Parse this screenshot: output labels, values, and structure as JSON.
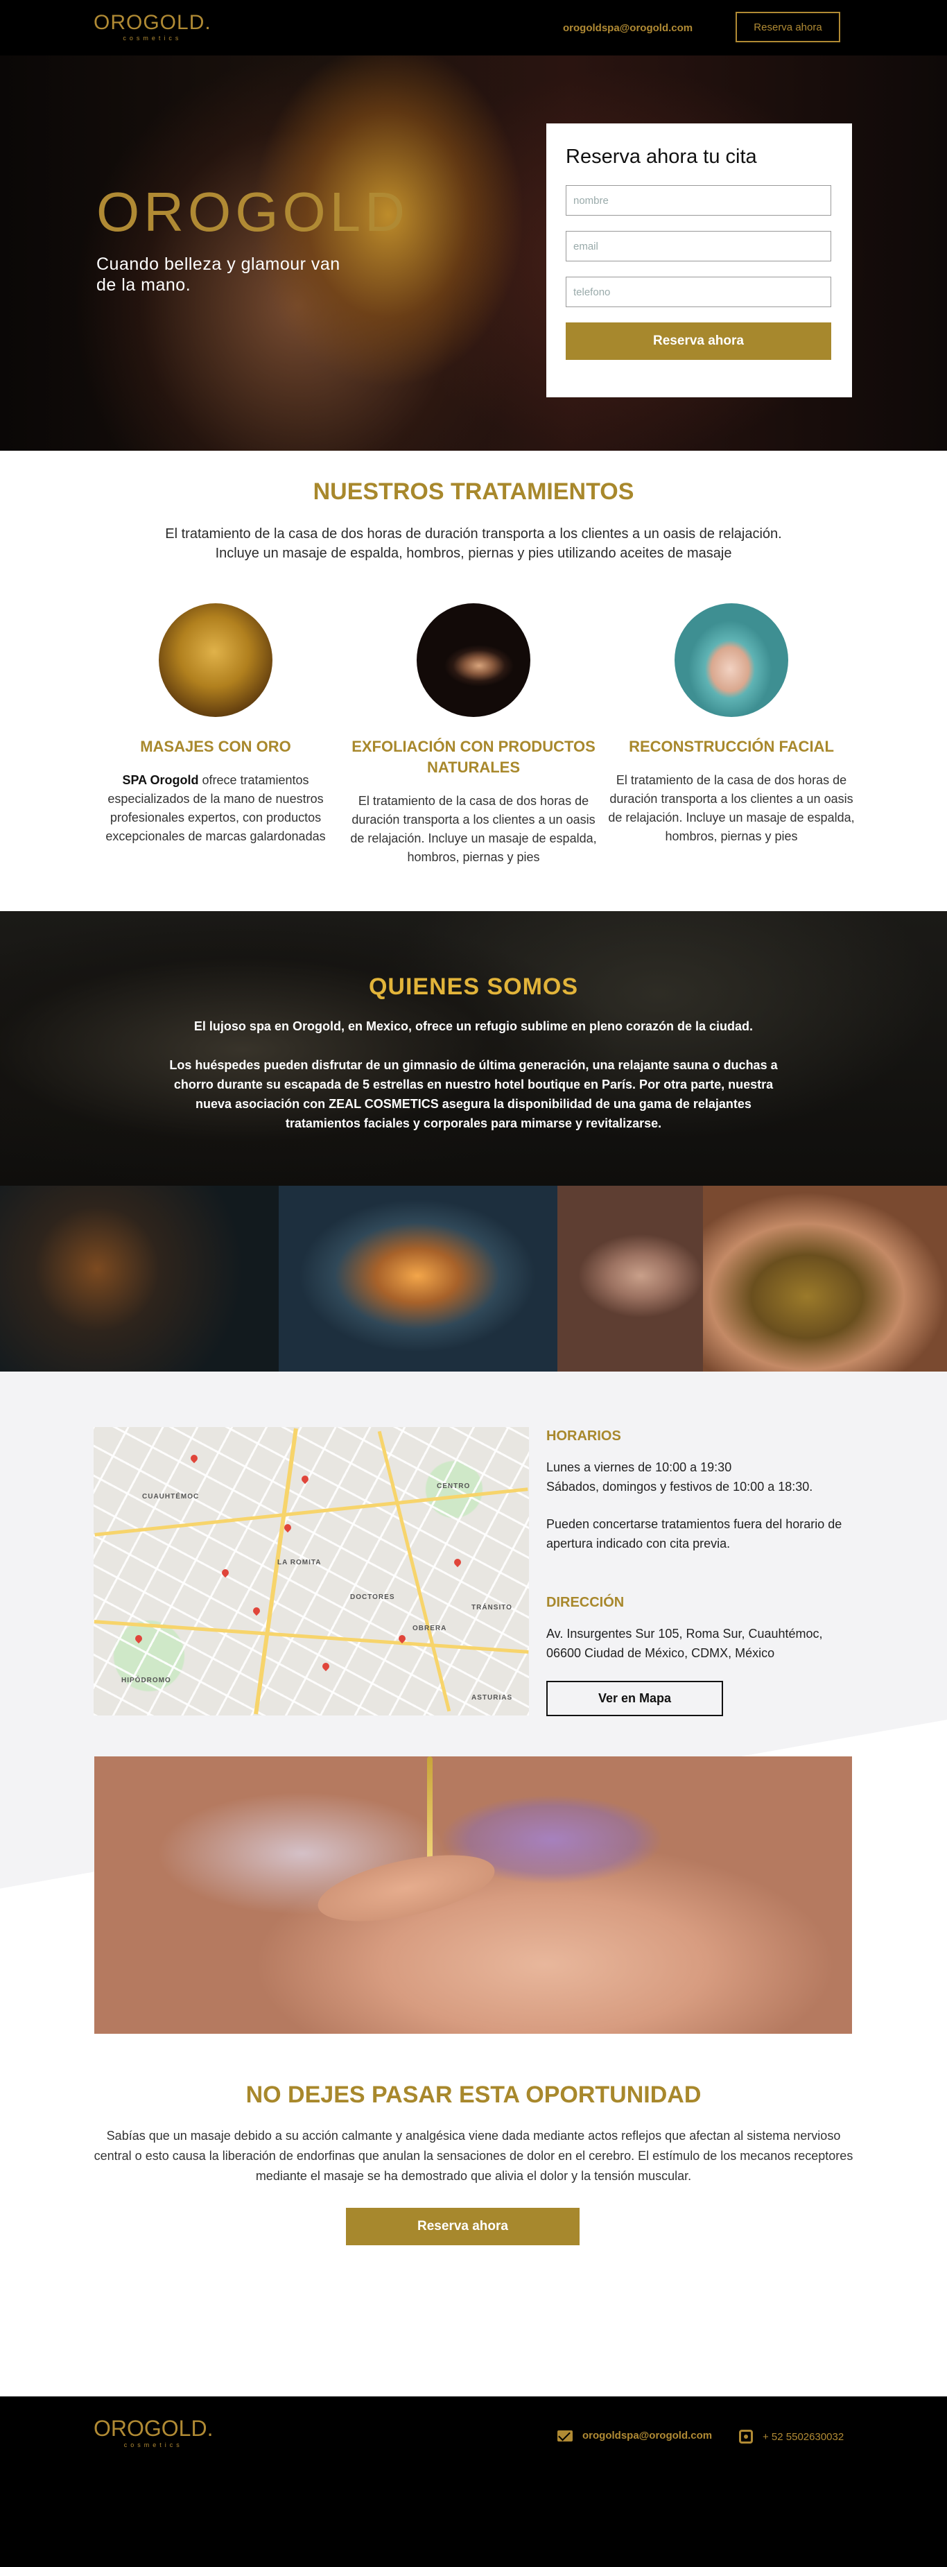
{
  "header": {
    "logo_main": "OROGOLD.",
    "logo_sub": "cosmetics",
    "email": "orogoldspa@orogold.com",
    "cta": "Reserva ahora"
  },
  "hero": {
    "title": "OROGOLD",
    "subtitle": "Cuando belleza y glamour van de la mano."
  },
  "booking": {
    "title": "Reserva ahora tu cita",
    "name_placeholder": "nombre",
    "email_placeholder": "email",
    "phone_placeholder": "telefono",
    "button": "Reserva ahora"
  },
  "treatments": {
    "title": "NUESTROS TRATAMIENTOS",
    "intro": "El tratamiento de la casa de dos horas de duración transporta a los clientes a un oasis de relajación. Incluye un masaje de espalda, hombros, piernas y pies utilizando aceites de masaje",
    "items": [
      {
        "title": "MASAJES CON ORO",
        "text_bold": "SPA Orogold",
        "text": " ofrece tratamientos especializados de la mano de nuestros profesionales expertos, con productos excepcionales de marcas galardonadas"
      },
      {
        "title": "EXFOLIACIÓN CON PRODUCTOS NATURALES",
        "text": "El tratamiento de la casa de dos horas de duración transporta a los clientes a un oasis de relajación. Incluye un masaje de espalda, hombros, piernas y pies"
      },
      {
        "title": "RECONSTRUCCIÓN FACIAL",
        "text": "El tratamiento de la casa de dos horas de duración transporta a los clientes a un oasis de relajación. Incluye un masaje de espalda, hombros, piernas y pies"
      }
    ]
  },
  "about": {
    "title": "QUIENES SOMOS",
    "p1": "El lujoso spa en Orogold, en Mexico, ofrece un refugio sublime en pleno corazón de la ciudad.",
    "p2": "Los huéspedes pueden disfrutar de un gimnasio de última generación, una relajante sauna o duchas a chorro durante su escapada de 5 estrellas en nuestro hotel boutique en París. Por otra parte, nuestra nueva asociación con ZEAL COSMETICS asegura la disponibilidad de una gama de relajantes tratamientos faciales y corporales para mimarse y revitalizarse."
  },
  "info": {
    "hours_title": "HORARIOS",
    "hours_1": "Lunes a viernes de 10:00 a 19:30",
    "hours_2": "Sábados, domingos y festivos de 10:00 a 18:30.",
    "hours_note": "Pueden concertarse tratamientos fuera del horario de apertura indicado con cita previa.",
    "address_title": "DIRECCIÓN",
    "address": "Av. Insurgentes Sur 105, Roma Sur, Cuauhtémoc, 06600 Ciudad de México, CDMX, México",
    "map_button": "Ver en Mapa",
    "map_labels": [
      "CUAUHTÉMOC",
      "DOCTORES",
      "OBRERA",
      "HIPÓDROMO",
      "ASTURIAS",
      "TRÁNSITO",
      "LA ROMITA",
      "CENTRO"
    ]
  },
  "cta": {
    "title": "NO DEJES PASAR ESTA OPORTUNIDAD",
    "text": "Sabías que un masaje debido a su acción calmante y analgésica viene dada mediante actos reflejos que afectan al sistema nervioso central o esto causa la liberación de endorfinas que anulan la sensaciones de dolor en el cerebro. El estímulo de los mecanos receptores mediante el masaje se ha demostrado que alivia el dolor y la tensión muscular.",
    "button": "Reserva ahora"
  },
  "footer": {
    "logo_main": "OROGOLD.",
    "logo_sub": "cosmetics",
    "email": "orogoldspa@orogold.com",
    "phone": "+ 52 5502630032",
    "email_icon": "mail-icon",
    "phone_icon": "phone-icon"
  },
  "colors": {
    "gold": "#a8882c",
    "dark": "#000000",
    "about_title": "#e2b43a"
  }
}
